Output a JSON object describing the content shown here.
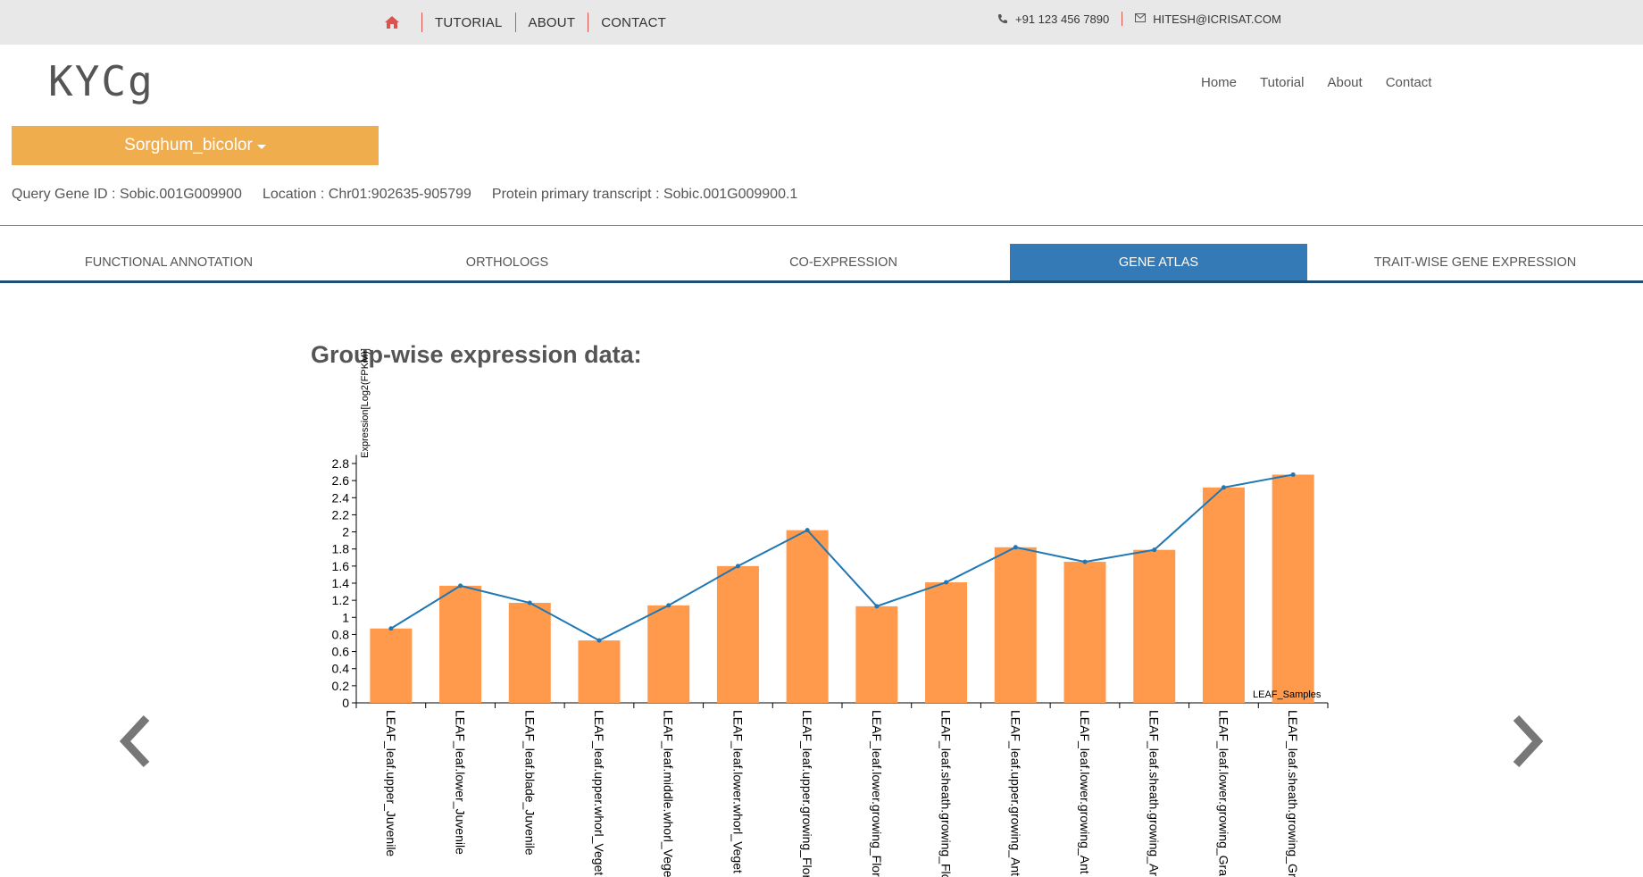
{
  "topbar": {
    "links": [
      "TUTORIAL",
      "ABOUT",
      "CONTACT"
    ],
    "phone": "+91 123 456 7890",
    "email": "HITESH@ICRISAT.COM"
  },
  "header": {
    "logo": "KYCg",
    "nav": [
      "Home",
      "Tutorial",
      "About",
      "Contact"
    ]
  },
  "species_dropdown": {
    "selected": "Sorghum_bicolor"
  },
  "gene_info": {
    "query": "Query Gene ID : Sobic.001G009900",
    "location": "Location : Chr01:902635-905799",
    "transcript": "Protein primary transcript : Sobic.001G009900.1"
  },
  "tabs": [
    {
      "label": "FUNCTIONAL ANNOTATION",
      "active": false
    },
    {
      "label": "ORTHOLOGS",
      "active": false
    },
    {
      "label": "CO-EXPRESSION",
      "active": false
    },
    {
      "label": "GENE ATLAS",
      "active": true
    },
    {
      "label": "TRAIT-WISE GENE EXPRESSION",
      "active": false
    }
  ],
  "section_title": "Group-wise expression data:",
  "colors": {
    "bar": "#ff9a4d",
    "line": "#1f77b4",
    "active_tab": "#337ab7",
    "dropdown": "#f0ad4e",
    "accent_red": "#d9534f"
  },
  "chart_data": {
    "type": "bar",
    "ylabel": "Expression[Log2(FPKM)]",
    "legend": "LEAF_Samples",
    "ylim": [
      0,
      2.9
    ],
    "yticks": [
      0,
      0.2,
      0.4,
      0.6,
      0.8,
      1,
      1.2,
      1.4,
      1.6,
      1.8,
      2,
      2.2,
      2.4,
      2.6,
      2.8
    ],
    "categories": [
      "LEAF_leaf.upper_Juvenile",
      "LEAF_leaf.lower_Juvenile",
      "LEAF_leaf.blade_Juvenile",
      "LEAF_leaf.upper.whorl_Veget",
      "LEAF_leaf.middle.whorl_Vege",
      "LEAF_leaf.lower.whorl_Veget",
      "LEAF_leaf.upper.growing_Flor",
      "LEAF_leaf.lower.growing_Flor",
      "LEAF_leaf.sheath.growing_Flo",
      "LEAF_leaf.upper.growing_Ant",
      "LEAF_leaf.lower.growing_Ant",
      "LEAF_leaf.sheath.growing_Ar",
      "LEAF_leaf.lower.growing_Gra",
      "LEAF_leaf.sheath.growing_Gr"
    ],
    "series": [
      {
        "values": [
          0.87,
          1.37,
          1.17,
          0.73,
          1.14,
          1.6,
          2.02,
          1.13,
          1.41,
          1.82,
          1.65,
          1.79,
          2.52,
          2.67
        ]
      }
    ]
  }
}
